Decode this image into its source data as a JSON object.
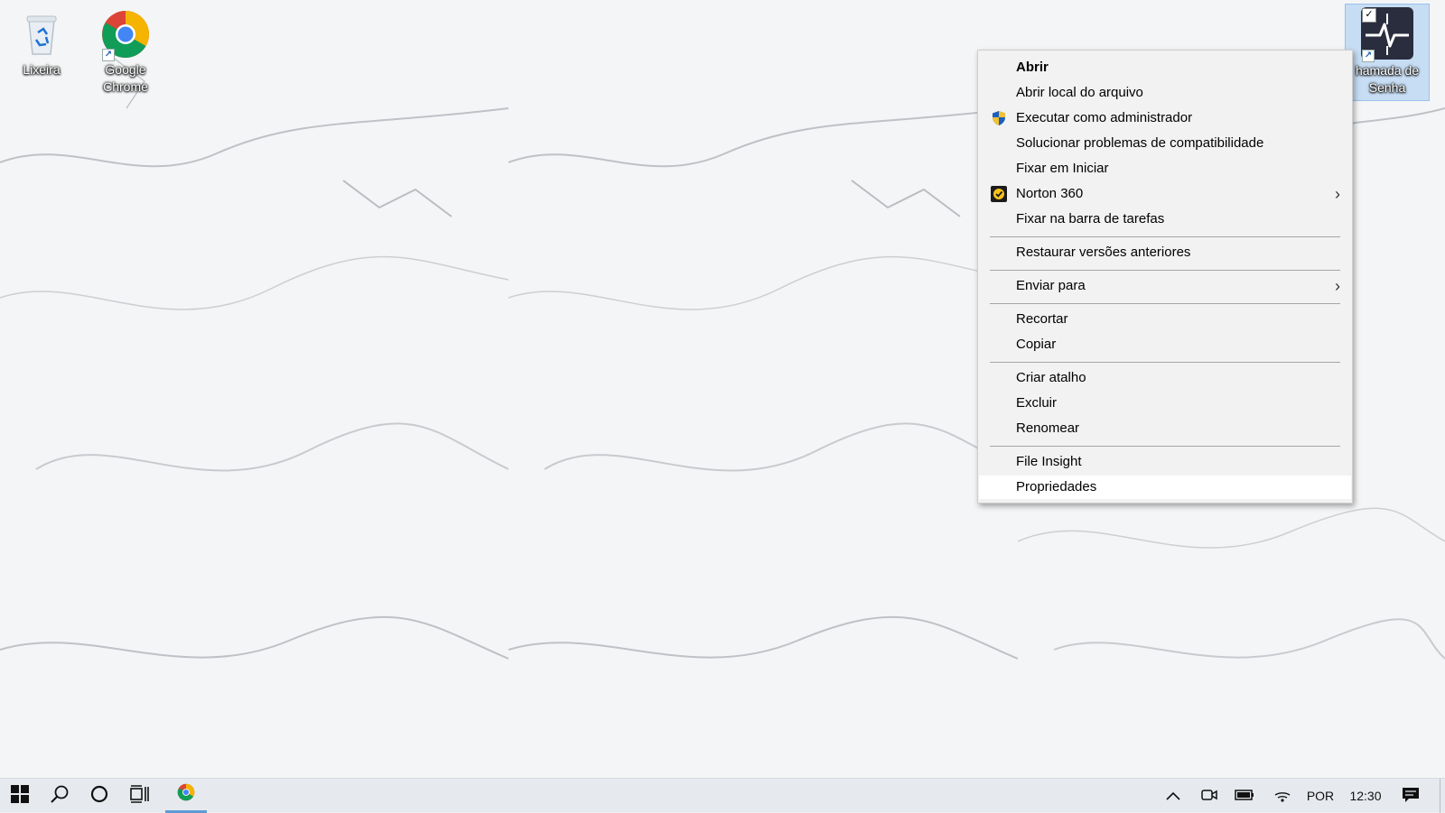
{
  "desktop": {
    "icons": [
      {
        "label": "Lixeira",
        "icon": "recycle-bin-icon"
      },
      {
        "label": "Google Chrome",
        "icon": "chrome-icon"
      },
      {
        "label": "hamada de Senha",
        "icon": "heartbeat-app-icon"
      }
    ]
  },
  "context_menu": {
    "items": [
      {
        "label": "Abrir",
        "bold": true
      },
      {
        "label": "Abrir local do arquivo"
      },
      {
        "label": "Executar como administrador",
        "icon": "uac-shield-icon"
      },
      {
        "label": "Solucionar problemas de compatibilidade"
      },
      {
        "label": "Fixar em Iniciar"
      },
      {
        "label": "Norton 360",
        "icon": "norton-icon",
        "submenu": true
      },
      {
        "label": "Fixar na barra de tarefas"
      },
      {
        "label": "Restaurar versões anteriores"
      },
      {
        "label": "Enviar para",
        "submenu": true
      },
      {
        "label": "Recortar"
      },
      {
        "label": "Copiar"
      },
      {
        "label": "Criar atalho"
      },
      {
        "label": "Excluir"
      },
      {
        "label": "Renomear"
      },
      {
        "label": "File Insight"
      },
      {
        "label": "Propriedades",
        "highlighted": true
      }
    ]
  },
  "taskbar": {
    "start": "windows-start-icon",
    "search": "search-icon",
    "cortana": "cortana-icon",
    "task_view": "task-view-icon",
    "pinned": [
      "chrome-icon"
    ],
    "tray": {
      "language": "POR",
      "clock": "12:30"
    }
  },
  "colors": {
    "menu_bg": "#f2f2f2",
    "menu_hover": "#ffffff",
    "taskbar_bg": "#e6e9ee",
    "accent": "#1a73e8"
  }
}
